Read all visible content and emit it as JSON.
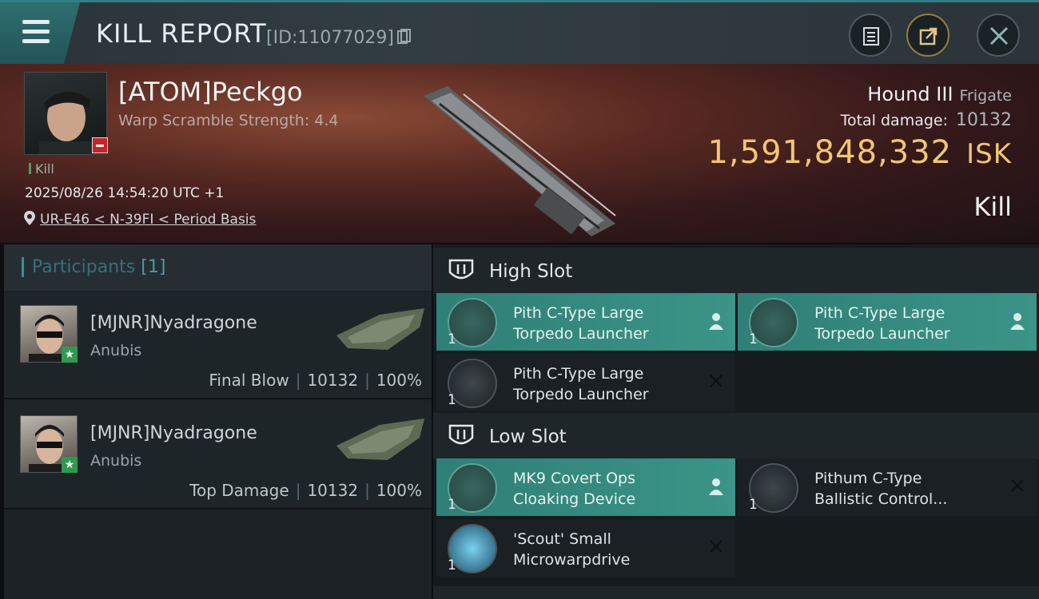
{
  "header": {
    "title": "KILL REPORT",
    "kill_id": "[ID:11077029]",
    "buttons": [
      "clipboard-icon",
      "share-icon",
      "close-icon"
    ]
  },
  "victim": {
    "name": "[ATOM]Peckgo",
    "warp_scramble": "Warp Scramble Strength: 4.4",
    "tag": "Kill",
    "timestamp": "2025/08/26 14:54:20 UTC +1",
    "location": "UR-E46 < N-39FI < Period Basis",
    "ship": "Hound III",
    "ship_class": "Frigate",
    "total_damage_label": "Total damage:",
    "total_damage": "10132",
    "isk_value": "1,591,848,332",
    "isk_unit": "ISK",
    "result": "Kill"
  },
  "participants": {
    "label": "Participants",
    "count": "[1]",
    "rows": [
      {
        "name": "[MJNR]Nyadragone",
        "ship": "Anubis",
        "role": "Final Blow",
        "damage": "10132",
        "percent": "100%"
      },
      {
        "name": "[MJNR]Nyadragone",
        "ship": "Anubis",
        "role": "Top Damage",
        "damage": "10132",
        "percent": "100%"
      }
    ]
  },
  "slots": {
    "high": {
      "label": "High Slot",
      "modules": [
        {
          "line1": "Pith C-Type Large",
          "line2": "Torpedo Launcher",
          "qty": "1",
          "state": "dropped"
        },
        {
          "line1": "Pith C-Type Large",
          "line2": "Torpedo Launcher",
          "qty": "1",
          "state": "dropped"
        },
        {
          "line1": "Pith C-Type Large",
          "line2": "Torpedo Launcher",
          "qty": "1",
          "state": "destroyed"
        }
      ]
    },
    "low": {
      "label": "Low Slot",
      "modules": [
        {
          "line1": "MK9 Covert Ops",
          "line2": "Cloaking Device",
          "qty": "1",
          "state": "dropped"
        },
        {
          "line1": "Pithum C-Type",
          "line2": "Ballistic Control...",
          "qty": "1",
          "state": "destroyed"
        },
        {
          "line1": "'Scout' Small",
          "line2": "Microwarpdrive",
          "qty": "1",
          "state": "destroyed"
        }
      ]
    }
  },
  "colors": {
    "accent": "#2f7f86",
    "loaded_module": "#3b9487",
    "isk": "#f1c770",
    "banner": "#5a2a22"
  }
}
